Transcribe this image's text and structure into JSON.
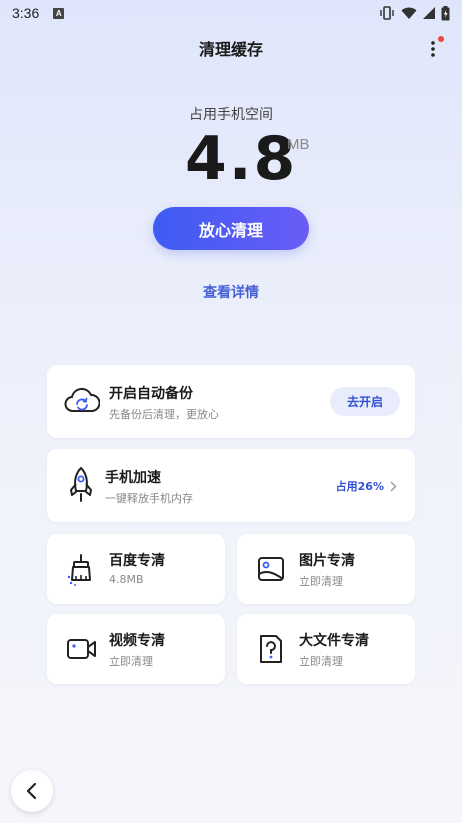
{
  "status_bar": {
    "time": "3:36",
    "notification_letter": "A"
  },
  "header": {
    "title": "清理缓存"
  },
  "usage": {
    "label": "占用手机空间",
    "value": "4.8",
    "unit": "MB"
  },
  "actions": {
    "clean_label": "放心清理",
    "detail_label": "查看详情"
  },
  "backup": {
    "title": "开启自动备份",
    "subtitle": "先备份后清理，更放心",
    "button_label": "去开启"
  },
  "speed": {
    "title": "手机加速",
    "subtitle": "一键释放手机内存",
    "usage_text": "占用26%"
  },
  "grid": [
    {
      "title": "百度专清",
      "subtitle": "4.8MB",
      "icon": "broom-icon"
    },
    {
      "title": "图片专清",
      "subtitle": "立即清理",
      "icon": "image-icon"
    },
    {
      "title": "视频专清",
      "subtitle": "立即清理",
      "icon": "video-camera-icon"
    },
    {
      "title": "大文件专清",
      "subtitle": "立即清理",
      "icon": "question-file-icon"
    }
  ],
  "colors": {
    "accent": "#3d5cf2",
    "accent_end": "#6a5cf7",
    "link": "#4661d8",
    "badge": "#f0453a"
  }
}
